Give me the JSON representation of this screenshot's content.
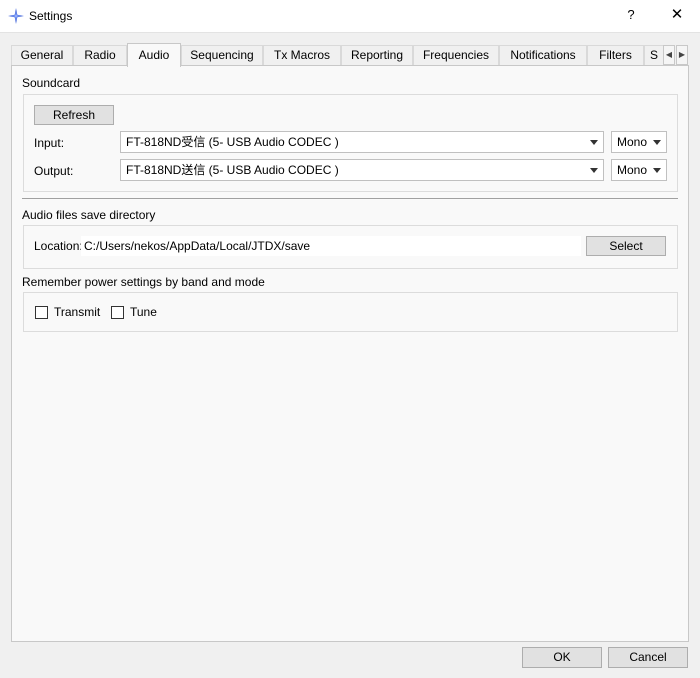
{
  "window": {
    "title": "Settings",
    "help": "?",
    "close": "✕"
  },
  "tabs": [
    {
      "label": "General"
    },
    {
      "label": "Radio"
    },
    {
      "label": "Audio",
      "active": true
    },
    {
      "label": "Sequencing"
    },
    {
      "label": "Tx Macros"
    },
    {
      "label": "Reporting"
    },
    {
      "label": "Frequencies"
    },
    {
      "label": "Notifications"
    },
    {
      "label": "Filters"
    },
    {
      "label": "S"
    }
  ],
  "soundcard": {
    "title": "Soundcard",
    "refresh_label": "Refresh",
    "input_label": "Input:",
    "input_device": "FT-818ND受信 (5- USB Audio CODEC )",
    "input_channel": "Mono",
    "output_label": "Output:",
    "output_device": "FT-818ND送信 (5- USB Audio CODEC )",
    "output_channel": "Mono"
  },
  "save_dir": {
    "title": "Audio files save directory",
    "location_label": "Location:",
    "path": "C:/Users/nekos/AppData/Local/JTDX/save",
    "select_label": "Select"
  },
  "power": {
    "title": "Remember power settings by band and mode",
    "transmit_label": "Transmit",
    "transmit_checked": false,
    "tune_label": "Tune",
    "tune_checked": false
  },
  "footer": {
    "ok_label": "OK",
    "cancel_label": "Cancel"
  }
}
